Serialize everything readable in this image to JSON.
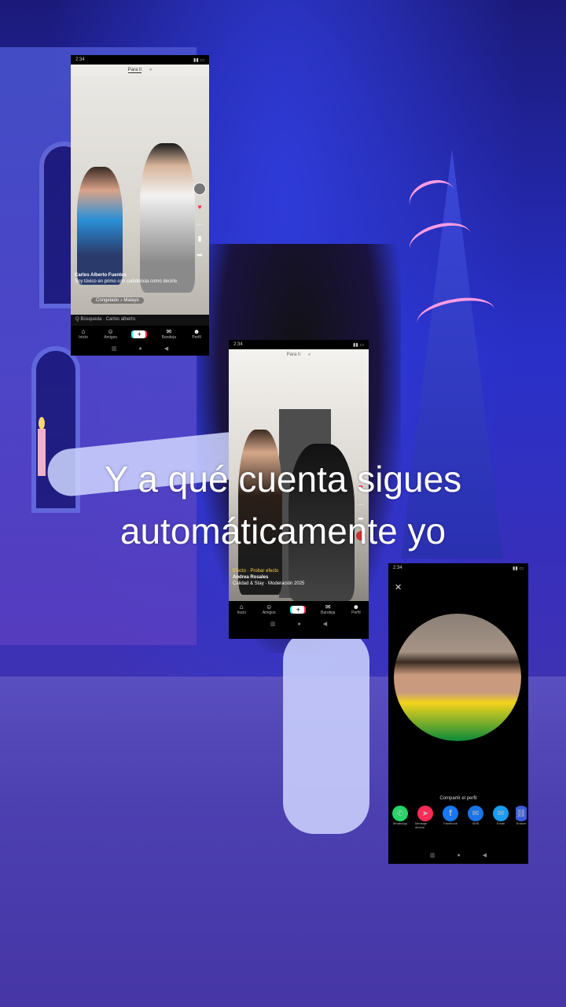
{
  "overlay_text": {
    "line1": "Y a qué cuenta sigues",
    "line2": "automáticamente yo"
  },
  "phone1": {
    "status_time": "2:34",
    "top_label": "Para ti",
    "username": "Carlos Alberto Fuentes",
    "caption": "Soy tóxico en primo con cadidencia como decirle",
    "effect_button": "Congelado ♪ Malayo",
    "search_hint": "Q  Búsqueda · Carlos alberto",
    "nav": [
      "Inicio",
      "Amigos",
      "+",
      "Bandeja",
      "Perfil"
    ]
  },
  "phone2": {
    "status_time": "2:34",
    "top_label": "Para ti",
    "effect": "Efecto · Probar efecto",
    "username": "Andrea Rosales",
    "caption": "Calidad & Stay · Moderación 2025",
    "nav": [
      "Inicio",
      "Amigos",
      "+",
      "Bandeja",
      "Perfil"
    ]
  },
  "phone3": {
    "status_time": "2:34",
    "share_title": "Compartir el perfil",
    "share_targets": [
      {
        "label": "WhatsApp",
        "icon": "whatsapp-icon",
        "color": "#25d366",
        "glyph": "✆"
      },
      {
        "label": "Mensaje directo",
        "icon": "send-icon",
        "color": "#fe2c55",
        "glyph": "➤"
      },
      {
        "label": "Facebook",
        "icon": "facebook-icon",
        "color": "#1877f2",
        "glyph": "f"
      },
      {
        "label": "SMS",
        "icon": "sms-icon",
        "color": "#1a73e8",
        "glyph": "✉"
      },
      {
        "label": "Email",
        "icon": "email-icon",
        "color": "#1a9cf0",
        "glyph": "✉"
      },
      {
        "label": "Enlace",
        "icon": "link-icon",
        "color": "#3b5bdb",
        "glyph": "⛓"
      }
    ]
  },
  "colors": {
    "tiktok_red": "#fe2c55",
    "tiktok_cyan": "#25f4ee",
    "brazil_yellow": "#f2d31b",
    "brazil_green": "#0b8a3a"
  }
}
